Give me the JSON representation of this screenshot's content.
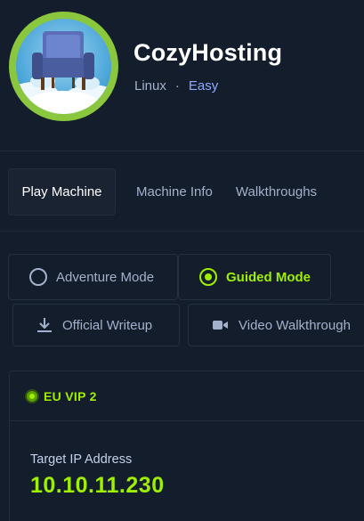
{
  "machine": {
    "name": "CozyHosting",
    "os": "Linux",
    "separator": "·",
    "difficulty": "Easy"
  },
  "tabs": [
    {
      "label": "Play Machine",
      "active": true
    },
    {
      "label": "Machine Info",
      "active": false
    },
    {
      "label": "Walkthroughs",
      "active": false
    }
  ],
  "modes": {
    "adventure": "Adventure Mode",
    "guided": "Guided Mode",
    "selected": "guided"
  },
  "resources": {
    "writeup": "Official Writeup",
    "video": "Video Walkthrough"
  },
  "connection": {
    "server": "EU VIP 2",
    "status_color": "#9fef00",
    "ip_label": "Target IP Address",
    "ip": "10.10.11.230"
  },
  "colors": {
    "background": "#141d2b",
    "accent": "#9fef00",
    "difficulty": "#8ea9ff"
  }
}
